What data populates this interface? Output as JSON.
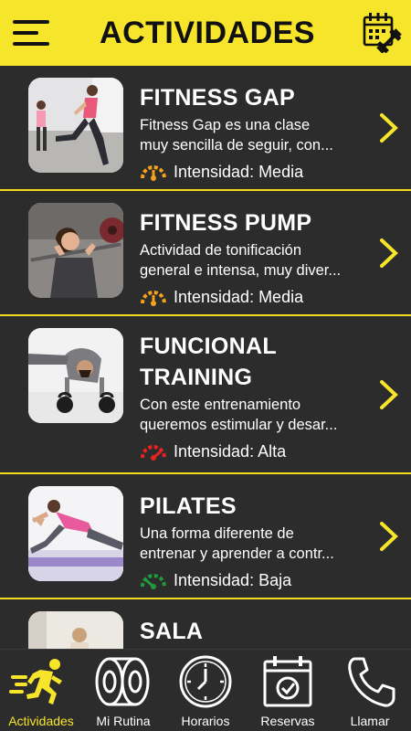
{
  "header": {
    "title": "ACTIVIDADES",
    "menu_icon": "hamburger-menu-icon",
    "calendar_icon": "calendar-dumbbell-icon"
  },
  "colors": {
    "accent": "#f6e52a",
    "background": "#2c2c2c",
    "intensity_media": "#f5a11c",
    "intensity_alta": "#e52323",
    "intensity_baja": "#1f9a3c"
  },
  "activities": [
    {
      "name": "FITNESS GAP",
      "description": "Fitness Gap es una clase\nmuy sencilla de seguir, con...",
      "intensity_label": "Intensidad: Media",
      "intensity_level": "media"
    },
    {
      "name": "FITNESS PUMP",
      "description": "Actividad de tonificación\ngeneral e intensa, muy diver...",
      "intensity_label": "Intensidad: Media",
      "intensity_level": "media"
    },
    {
      "name": "FUNCIONAL\nTRAINING",
      "description": "Con este entrenamiento\nqueremos estimular y desar...",
      "intensity_label": "Intensidad: Alta",
      "intensity_level": "alta"
    },
    {
      "name": "PILATES",
      "description": "Una forma diferente de\nentrenar y aprender a contr...",
      "intensity_label": "Intensidad: Baja",
      "intensity_level": "baja"
    },
    {
      "name": "SALA",
      "description": "",
      "intensity_label": "",
      "intensity_level": ""
    }
  ],
  "tabs": [
    {
      "label": "Actividades",
      "icon": "running-person-icon",
      "active": true
    },
    {
      "label": "Mi Rutina",
      "icon": "weight-plates-icon",
      "active": false
    },
    {
      "label": "Horarios",
      "icon": "clock-icon",
      "active": false
    },
    {
      "label": "Reservas",
      "icon": "calendar-check-icon",
      "active": false
    },
    {
      "label": "Llamar",
      "icon": "phone-icon",
      "active": false
    }
  ]
}
